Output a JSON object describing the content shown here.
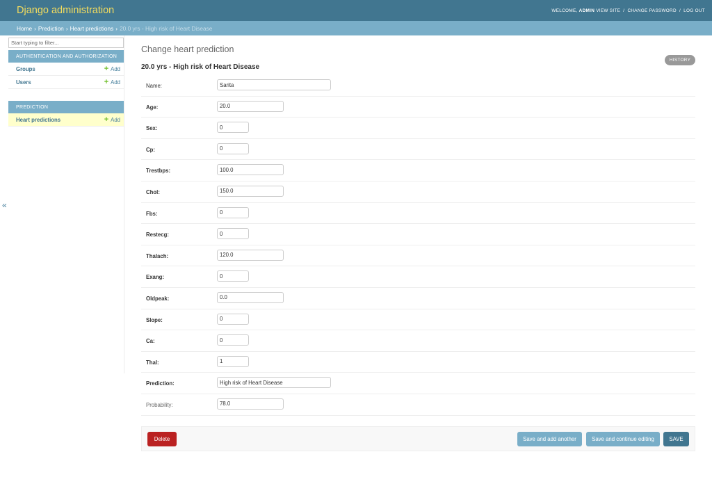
{
  "header": {
    "branding": "Django administration",
    "welcome": "WELCOME,",
    "username": "ADMIN",
    "view_site": "VIEW SITE",
    "change_password": "CHANGE PASSWORD",
    "log_out": "LOG OUT",
    "separator": "/"
  },
  "breadcrumbs": {
    "home": "Home",
    "app": "Prediction",
    "model": "Heart predictions",
    "current": "20.0 yrs - High risk of Heart Disease",
    "separator": "›"
  },
  "sidebar": {
    "filter_placeholder": "Start typing to filter...",
    "modules": [
      {
        "caption": "Authentication and Authorization",
        "models": [
          {
            "name": "Groups",
            "add_label": "Add"
          },
          {
            "name": "Users",
            "add_label": "Add"
          }
        ]
      },
      {
        "caption": "Prediction",
        "models": [
          {
            "name": "Heart predictions",
            "add_label": "Add"
          }
        ]
      }
    ],
    "toggle_glyph": "«"
  },
  "content": {
    "page_title": "Change heart prediction",
    "history_label": "HISTORY",
    "object_title": "20.0 yrs - High risk of Heart Disease",
    "fields": [
      {
        "label": "Name:",
        "value": "Sarita"
      },
      {
        "label": "Age:",
        "value": "20.0"
      },
      {
        "label": "Sex:",
        "value": "0"
      },
      {
        "label": "Cp:",
        "value": "0"
      },
      {
        "label": "Trestbps:",
        "value": "100.0"
      },
      {
        "label": "Chol:",
        "value": "150.0"
      },
      {
        "label": "Fbs:",
        "value": "0"
      },
      {
        "label": "Restecg:",
        "value": "0"
      },
      {
        "label": "Thalach:",
        "value": "120.0"
      },
      {
        "label": "Exang:",
        "value": "0"
      },
      {
        "label": "Oldpeak:",
        "value": "0.0"
      },
      {
        "label": "Slope:",
        "value": "0"
      },
      {
        "label": "Ca:",
        "value": "0"
      },
      {
        "label": "Thal:",
        "value": "1"
      },
      {
        "label": "Prediction:",
        "value": "High risk of Heart Disease"
      },
      {
        "label": "Probability:",
        "value": "78.0"
      }
    ]
  },
  "submit": {
    "delete": "Delete",
    "save_add": "Save and add another",
    "save_continue": "Save and continue editing",
    "save": "SAVE"
  },
  "colors": {
    "header_bg": "#417690",
    "branding": "#f5dd5d",
    "breadcrumb_bg": "#79aec8",
    "delete": "#ba2121",
    "primary": "#417690",
    "secondary_button": "#79aec8",
    "current_model_bg": "#ffffcc",
    "add_icon": "#70bf2b"
  }
}
